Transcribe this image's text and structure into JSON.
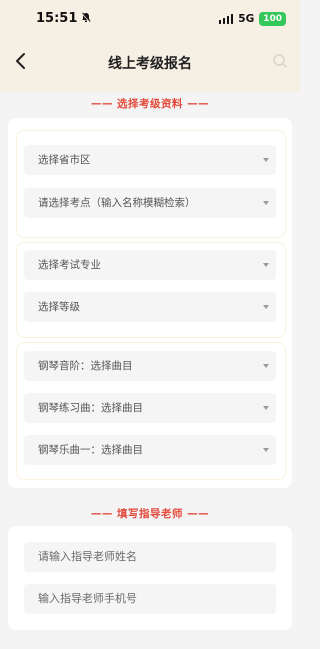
{
  "status": {
    "time": "15:51",
    "network": "5G",
    "battery": "100"
  },
  "nav": {
    "title": "线上考级报名"
  },
  "section1": {
    "title": "—— 选择考级资料 ——"
  },
  "selects": {
    "region": "选择省市区",
    "exam_site": "请选择考点（输入名称模糊检索）",
    "major": "选择考试专业",
    "level": "选择等级",
    "scale": "钢琴音阶：选择曲目",
    "etude": "钢琴练习曲：选择曲目",
    "piece1": "钢琴乐曲一：选择曲目"
  },
  "section2": {
    "title": "—— 填写指导老师 ——"
  },
  "teacher": {
    "name_placeholder": "请输入指导老师姓名",
    "phone_placeholder": "输入指导老师手机号"
  }
}
